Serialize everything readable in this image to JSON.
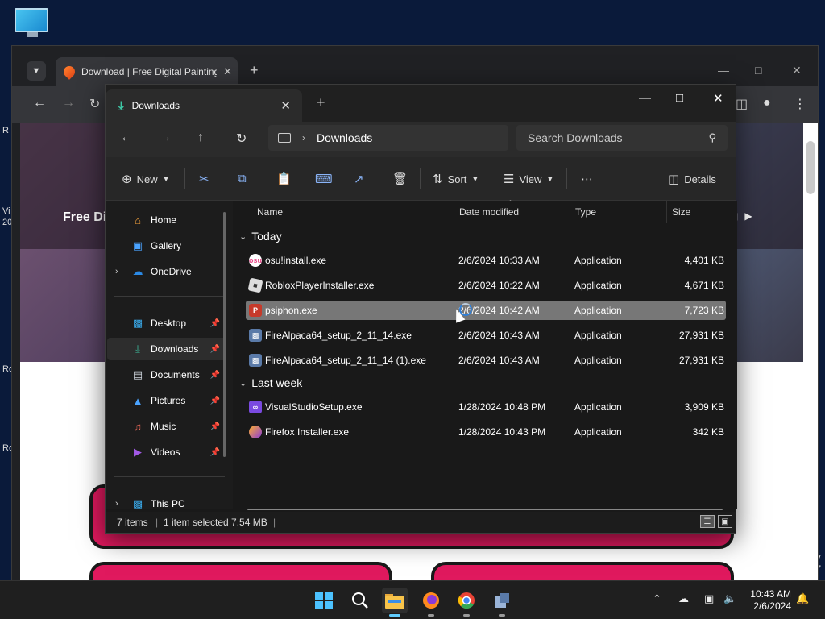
{
  "desktop": {
    "side_labels": [
      "R",
      "Vi",
      "20",
      "Ro",
      "Ro"
    ],
    "right_labels": [
      "v",
      "7"
    ]
  },
  "chrome": {
    "tab_title": "Download | Free Digital Painting",
    "hero_title": "Free Di"
  },
  "explorer": {
    "tab_title": "Downloads",
    "address_path": "Downloads",
    "search_placeholder": "Search Downloads",
    "commands": {
      "new": "New",
      "sort": "Sort",
      "view": "View",
      "details": "Details"
    },
    "sidebar": [
      {
        "label": "Home",
        "icon": "home-icon"
      },
      {
        "label": "Gallery",
        "icon": "gallery-icon"
      },
      {
        "label": "OneDrive",
        "icon": "cloud-icon"
      },
      {
        "label": "Desktop",
        "icon": "desktop-icon"
      },
      {
        "label": "Downloads",
        "icon": "download-icon"
      },
      {
        "label": "Documents",
        "icon": "document-icon"
      },
      {
        "label": "Pictures",
        "icon": "picture-icon"
      },
      {
        "label": "Music",
        "icon": "music-icon"
      },
      {
        "label": "Videos",
        "icon": "video-icon"
      },
      {
        "label": "This PC",
        "icon": "pc-icon"
      }
    ],
    "columns": {
      "name": "Name",
      "date": "Date modified",
      "type": "Type",
      "size": "Size"
    },
    "groups": {
      "today": "Today",
      "last_week": "Last week"
    },
    "files": [
      {
        "name": "osu!install.exe",
        "date": "2/6/2024 10:33 AM",
        "type": "Application",
        "size": "4,401 KB",
        "icon": "osu-icon"
      },
      {
        "name": "RobloxPlayerInstaller.exe",
        "date": "2/6/2024 10:22 AM",
        "type": "Application",
        "size": "4,671 KB",
        "icon": "roblox-icon"
      },
      {
        "name": "psiphon.exe",
        "date": "2/6/2024 10:42 AM",
        "type": "Application",
        "size": "7,723 KB",
        "icon": "psiphon-icon"
      },
      {
        "name": "FireAlpaca64_setup_2_11_14.exe",
        "date": "2/6/2024 10:43 AM",
        "type": "Application",
        "size": "27,931 KB",
        "icon": "installer-icon"
      },
      {
        "name": "FireAlpaca64_setup_2_11_14 (1).exe",
        "date": "2/6/2024 10:43 AM",
        "type": "Application",
        "size": "27,931 KB",
        "icon": "installer-icon"
      },
      {
        "name": "VisualStudioSetup.exe",
        "date": "1/28/2024 10:48 PM",
        "type": "Application",
        "size": "3,909 KB",
        "icon": "visual-studio-icon"
      },
      {
        "name": "Firefox Installer.exe",
        "date": "1/28/2024 10:43 PM",
        "type": "Application",
        "size": "342 KB",
        "icon": "firefox-icon"
      }
    ],
    "status": {
      "count": "7 items",
      "selected": "1 item selected  7.54 MB"
    }
  },
  "taskbar": {
    "time": "10:43 AM",
    "date": "2/6/2024"
  },
  "colors": {
    "accent": "#60cdff",
    "pink": "#e0195e",
    "selected_row": "#777777"
  }
}
